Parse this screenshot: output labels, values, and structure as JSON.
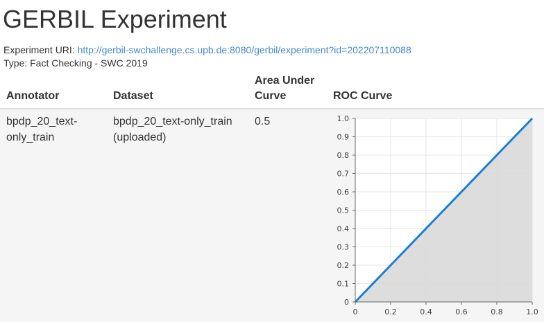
{
  "page": {
    "title": "GERBIL Experiment",
    "uri_label": "Experiment URI:",
    "uri": "http://gerbil-swchallenge.cs.upb.de:8080/gerbil/experiment?id=202207110088",
    "type_text": "Type: Fact Checking - SWC 2019"
  },
  "table": {
    "headers": {
      "annotator": "Annotator",
      "dataset": "Dataset",
      "auc": "Area Under Curve",
      "roc": "ROC Curve"
    },
    "rows": [
      {
        "annotator": "bpdp_20_text-only_train",
        "dataset": "bpdp_20_text-only_train (uploaded)",
        "auc": "0.5"
      }
    ]
  },
  "chart_data": {
    "type": "area",
    "x": [
      0,
      1
    ],
    "series": [
      {
        "values": [
          0,
          1
        ]
      }
    ],
    "xlim": [
      0,
      1
    ],
    "ylim": [
      0,
      1
    ],
    "x_ticks": [
      "0",
      "0.2",
      "0.4",
      "0.6",
      "0.8",
      "1.0"
    ],
    "y_ticks": [
      "0",
      "0.1",
      "0.2",
      "0.3",
      "0.4",
      "0.5",
      "0.6",
      "0.7",
      "0.8",
      "0.9",
      "1.0"
    ],
    "grid": true,
    "line_color": "#1a7fd4",
    "fill_color": "#d9d9d9"
  }
}
